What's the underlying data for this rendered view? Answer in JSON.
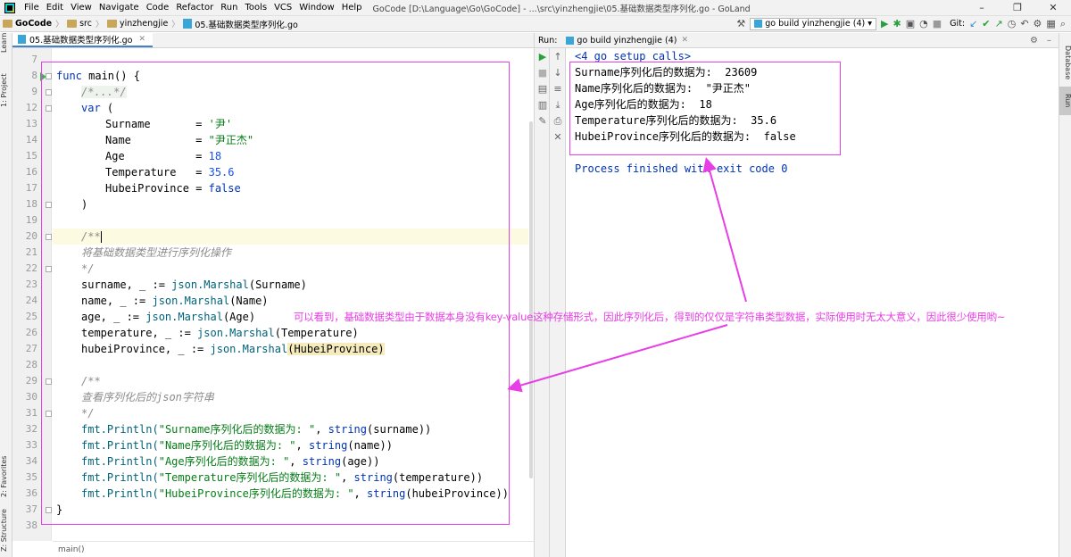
{
  "window": {
    "title": "GoCode [D:\\Language\\Go\\GoCode] - ...\\src\\yinzhengjie\\05.基础数据类型序列化.go - GoLand",
    "menu": [
      "File",
      "Edit",
      "View",
      "Navigate",
      "Code",
      "Refactor",
      "Run",
      "Tools",
      "VCS",
      "Window",
      "Help"
    ],
    "controls": {
      "minimize": "–",
      "maximize": "❐",
      "close": "✕"
    }
  },
  "breadcrumb": {
    "project": "GoCode",
    "folder1": "src",
    "folder2": "yinzhengjie",
    "file": "05.基础数据类型序列化.go",
    "separator": "〉"
  },
  "toolbar": {
    "run_config": "go build yinzhengjie (4)",
    "git_label": "Git:"
  },
  "left_tool_tabs": {
    "learn": "Learn",
    "project": "1: Project",
    "favorites": "2: Favorites",
    "structure": "Z: Structure"
  },
  "right_tool_tabs": {
    "database": "Database",
    "run": "Run"
  },
  "editor": {
    "tab_label": "05.基础数据类型序列化.go",
    "status": "main()",
    "lines": [
      {
        "n": "7"
      },
      {
        "n": "8"
      },
      {
        "n": "9"
      },
      {
        "n": "12"
      },
      {
        "n": "13"
      },
      {
        "n": "14"
      },
      {
        "n": "15"
      },
      {
        "n": "16"
      },
      {
        "n": "17"
      },
      {
        "n": "18"
      },
      {
        "n": "19"
      },
      {
        "n": "20"
      },
      {
        "n": "21"
      },
      {
        "n": "22"
      },
      {
        "n": "23"
      },
      {
        "n": "24"
      },
      {
        "n": "25"
      },
      {
        "n": "26"
      },
      {
        "n": "27"
      },
      {
        "n": "28"
      },
      {
        "n": "29"
      },
      {
        "n": "30"
      },
      {
        "n": "31"
      },
      {
        "n": "32"
      },
      {
        "n": "33"
      },
      {
        "n": "34"
      },
      {
        "n": "35"
      },
      {
        "n": "36"
      },
      {
        "n": "37"
      },
      {
        "n": "38"
      }
    ],
    "code": {
      "l8_kw": "func",
      "l8_rest": " main() {",
      "l9": "/*...*/",
      "l12_kw": "var",
      "l12_rest": " (",
      "l13_name": "Surname       = ",
      "l13_val": "'尹'",
      "l14_name": "Name          = ",
      "l14_val": "\"尹正杰\"",
      "l15_name": "Age           = ",
      "l15_val": "18",
      "l16_name": "Temperature   = ",
      "l16_val": "35.6",
      "l17_name": "HubeiProvince = ",
      "l17_val": "false",
      "l18": ")",
      "l20": "/**",
      "l21": "将基础数据类型进行序列化操作",
      "l22": "*/",
      "l23_a": "surname, _ := ",
      "l23_pkg": "json",
      "l23_fn": ".Marshal",
      "l23_b": "(Surname)",
      "l24_a": "name, _ := ",
      "l24_b": "(Name)",
      "l25_a": "age, _ := ",
      "l25_b": "(Age)",
      "l26_a": "temperature, _ := ",
      "l26_b": "(Temperature)",
      "l27_a": "hubeiProvince, _ := ",
      "l27_hl": "HubeiProvince",
      "l27_open": "(",
      "l27_close": ")",
      "l29": "/**",
      "l30": "查看序列化后的json字符串",
      "l31": "*/",
      "fmt": "fmt",
      "println": ".Println(",
      "string_fn": "string",
      "l32_str": "\"Surname序列化后的数据为: \"",
      "l32_tail": "(surname))",
      "l33_str": "\"Name序列化后的数据为: \"",
      "l33_tail": "(name))",
      "l34_str": "\"Age序列化后的数据为: \"",
      "l34_tail": "(age))",
      "l35_str": "\"Temperature序列化后的数据为: \"",
      "l35_tail": "(temperature))",
      "l36_str": "\"HubeiProvince序列化后的数据为: \"",
      "l36_tail": "(hubeiProvince))",
      "comma": ", ",
      "l37": "}"
    }
  },
  "run_panel": {
    "label": "Run:",
    "tab": "go build yinzhengjie (4)",
    "output": {
      "calls": "<4 go setup calls>",
      "line1": "Surname序列化后的数据为:  23609",
      "line2": "Name序列化后的数据为:  \"尹正杰\"",
      "line3": "Age序列化后的数据为:  18",
      "line4": "Temperature序列化后的数据为:  35.6",
      "line5": "HubeiProvince序列化后的数据为:  false",
      "exit": "Process finished with exit code 0"
    }
  },
  "annotation": {
    "text": "可以看到，基础数据类型由于数据本身没有key-value这种存储形式，因此序列化后，得到的仅仅是字符串类型数据，实际使用时无太大意义，因此很少使用哟~",
    "color": "#e83ee6"
  }
}
